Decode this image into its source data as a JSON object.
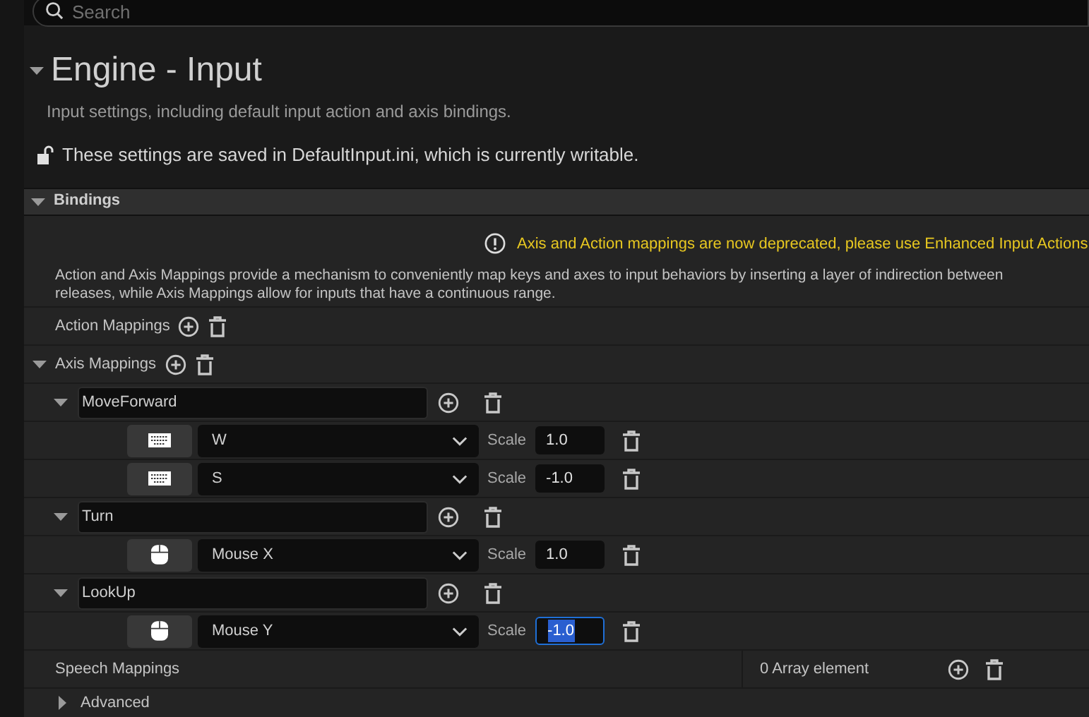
{
  "search": {
    "placeholder": "Search"
  },
  "section": {
    "title": "Engine - Input",
    "expanded": true,
    "subtitle": "Input settings, including default input action and axis bindings.",
    "save_note": "These settings are saved in DefaultInput.ini, which is currently writable."
  },
  "bindings": {
    "label": "Bindings",
    "expanded": true,
    "warning": "Axis and Action mappings are now deprecated, please use Enhanced Input Actions",
    "description_lines": [
      "Action and Axis Mappings provide a mechanism to conveniently map keys and axes to input behaviors by inserting a layer of indirection between",
      "releases, while Axis Mappings allow for inputs that have a continuous range."
    ],
    "action_mappings": {
      "label": "Action Mappings"
    },
    "axis_mappings": {
      "label": "Axis Mappings",
      "expanded": true,
      "items": [
        {
          "name": "MoveForward",
          "expanded": true,
          "keys": [
            {
              "kind": "keyboard",
              "key": "W",
              "scale_label": "Scale",
              "scale": "1.0",
              "focused": false
            },
            {
              "kind": "keyboard",
              "key": "S",
              "scale_label": "Scale",
              "scale": "-1.0",
              "focused": false
            }
          ]
        },
        {
          "name": "Turn",
          "expanded": true,
          "keys": [
            {
              "kind": "mouse",
              "key": "Mouse X",
              "scale_label": "Scale",
              "scale": "1.0",
              "focused": false
            }
          ]
        },
        {
          "name": "LookUp",
          "expanded": true,
          "keys": [
            {
              "kind": "mouse",
              "key": "Mouse Y",
              "scale_label": "Scale",
              "scale": "-1.0",
              "focused": true
            }
          ]
        }
      ]
    },
    "speech_mappings": {
      "label": "Speech Mappings",
      "count": "0 Array element"
    }
  },
  "advanced": {
    "label": "Advanced",
    "expanded": false
  }
}
